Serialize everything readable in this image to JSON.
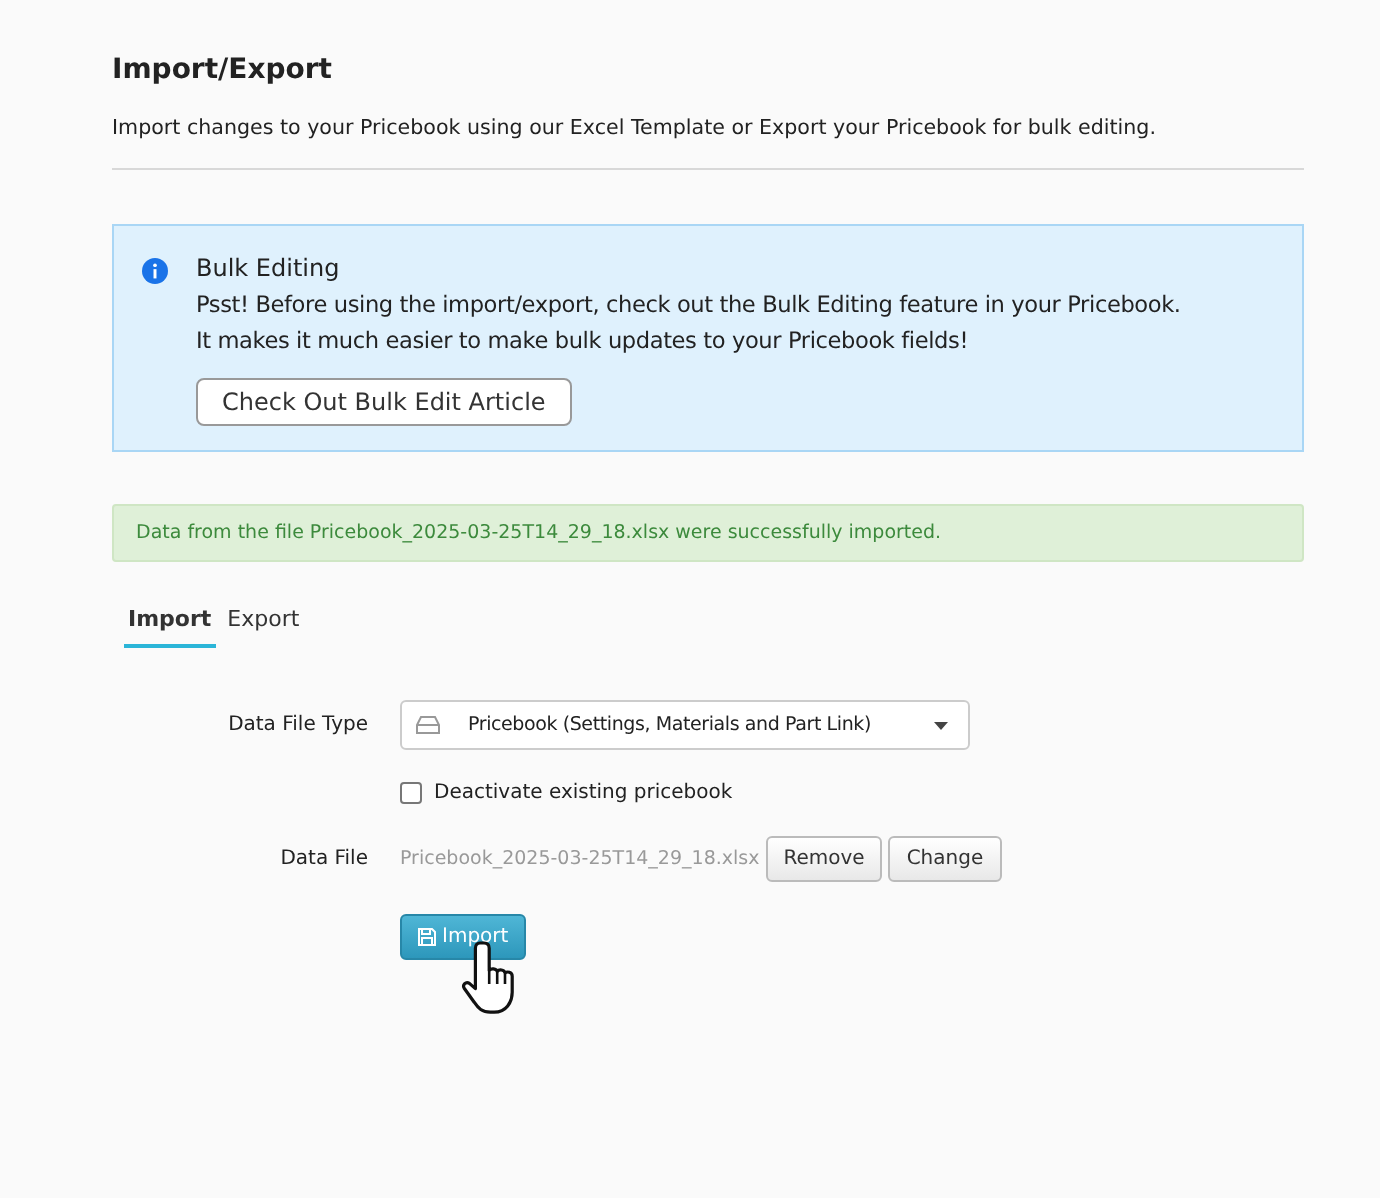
{
  "header": {
    "title": "Import/Export",
    "subtitle": "Import changes to your Pricebook using our Excel Template or Export your Pricebook for bulk editing."
  },
  "info": {
    "title": "Bulk Editing",
    "lines": [
      "Psst! Before using the import/export, check out the Bulk Editing feature in your Pricebook.",
      "It makes it much easier to make bulk updates to your Pricebook fields!"
    ],
    "button": "Check Out Bulk Edit Article"
  },
  "success": "Data from the file Pricebook_2025-03-25T14_29_18.xlsx were successfully imported.",
  "tabs": [
    {
      "label": "Import",
      "selected": true
    },
    {
      "label": "Export",
      "selected": false
    }
  ],
  "form": {
    "type_label": "Data File Type",
    "type_value": "Pricebook (Settings, Materials and Part Link)",
    "deactivate": {
      "label": "Deactivate existing pricebook",
      "checked": false
    },
    "file_label": "Data File",
    "file_name": "Pricebook_2025-03-25T14_29_18.xlsx",
    "buttons": [
      "Remove",
      "Change"
    ],
    "submit": "Import"
  }
}
